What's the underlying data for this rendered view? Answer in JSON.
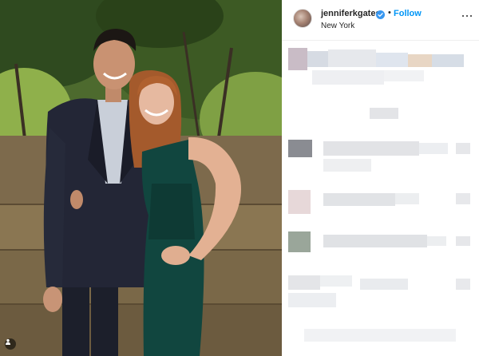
{
  "post": {
    "username": "jenniferkgates",
    "follow_label": "Follow",
    "separator": "•",
    "location": "New York",
    "icons": {
      "avatar": "profile-avatar",
      "verified": "verified-badge-icon",
      "more": "more-options-icon",
      "tagged": "tagged-people-icon"
    },
    "colors": {
      "follow": "#0095f6",
      "verified": "#3897f0",
      "text": "#262626"
    }
  },
  "photo": {
    "description_icon": "photo"
  }
}
